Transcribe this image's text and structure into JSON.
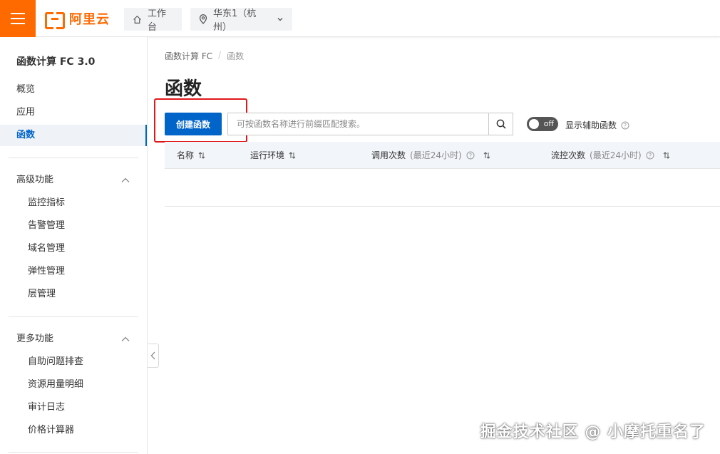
{
  "brand": {
    "logo_text": "阿里云",
    "accent": "#ff6a00"
  },
  "header": {
    "workbench_label": "工作台",
    "region_label": "华东1（杭州）"
  },
  "sidebar": {
    "title": "函数计算 FC 3.0",
    "items": [
      {
        "label": "概览",
        "active": false
      },
      {
        "label": "应用",
        "active": false
      },
      {
        "label": "函数",
        "active": true
      }
    ],
    "groups": [
      {
        "label": "高级功能",
        "items": [
          "监控指标",
          "告警管理",
          "域名管理",
          "弹性管理",
          "层管理"
        ]
      },
      {
        "label": "更多功能",
        "items": [
          "自助问题排查",
          "资源用量明细",
          "审计日志",
          "价格计算器"
        ]
      }
    ]
  },
  "main": {
    "breadcrumb": [
      "函数计算 FC",
      "函数"
    ],
    "title": "函数",
    "create_button": "创建函数",
    "search_placeholder": "可按函数名称进行前缀匹配搜索。",
    "toggle_state": "off",
    "toggle_label": "显示辅助函数",
    "columns": [
      {
        "label": "名称",
        "extra": ""
      },
      {
        "label": "运行环境",
        "extra": ""
      },
      {
        "label": "调用次数",
        "extra": "(最近24小时)"
      },
      {
        "label": "流控次数",
        "extra": "(最近24小时)"
      }
    ],
    "primary_color": "#0064c8"
  },
  "watermark": "掘金技术社区 @ 小摩托重名了"
}
